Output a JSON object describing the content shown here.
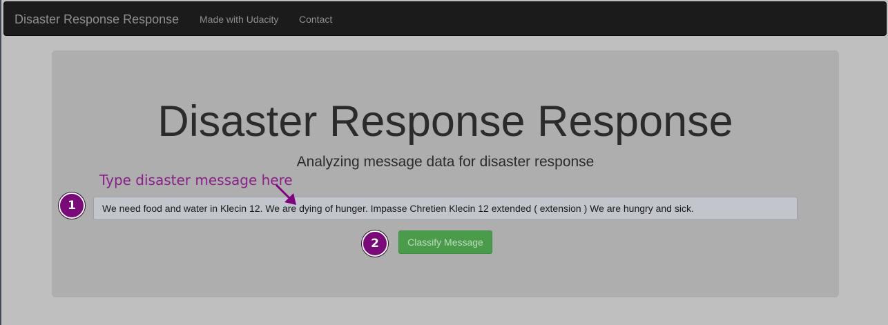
{
  "navbar": {
    "brand": "Disaster Response Response",
    "links": [
      "Made with Udacity",
      "Contact"
    ]
  },
  "main": {
    "title": "Disaster Response Response",
    "subtitle": "Analyzing message data for disaster response",
    "message_input_value": "We need food and water in Klecin 12. We are dying of hunger. Impasse Chretien Klecin 12 extended ( extension ) We are hungry and sick.",
    "classify_button": "Classify Message"
  },
  "annotations": {
    "hint": "Type disaster message here",
    "step_one": "1",
    "step_two": "2",
    "color": "#800080"
  },
  "icons": {
    "hint_arrow": "arrow-down-right-icon"
  }
}
